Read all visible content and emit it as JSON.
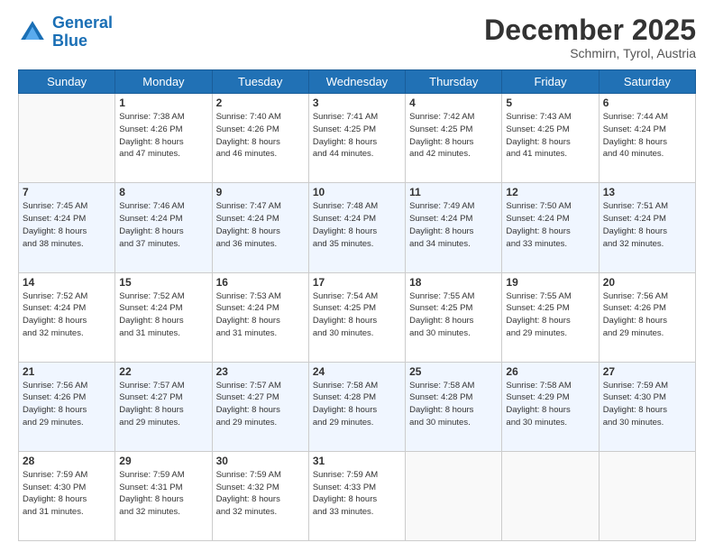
{
  "header": {
    "logo_line1": "General",
    "logo_line2": "Blue",
    "month": "December 2025",
    "location": "Schmirn, Tyrol, Austria"
  },
  "days_of_week": [
    "Sunday",
    "Monday",
    "Tuesday",
    "Wednesday",
    "Thursday",
    "Friday",
    "Saturday"
  ],
  "weeks": [
    [
      {
        "day": "",
        "info": ""
      },
      {
        "day": "1",
        "info": "Sunrise: 7:38 AM\nSunset: 4:26 PM\nDaylight: 8 hours\nand 47 minutes."
      },
      {
        "day": "2",
        "info": "Sunrise: 7:40 AM\nSunset: 4:26 PM\nDaylight: 8 hours\nand 46 minutes."
      },
      {
        "day": "3",
        "info": "Sunrise: 7:41 AM\nSunset: 4:25 PM\nDaylight: 8 hours\nand 44 minutes."
      },
      {
        "day": "4",
        "info": "Sunrise: 7:42 AM\nSunset: 4:25 PM\nDaylight: 8 hours\nand 42 minutes."
      },
      {
        "day": "5",
        "info": "Sunrise: 7:43 AM\nSunset: 4:25 PM\nDaylight: 8 hours\nand 41 minutes."
      },
      {
        "day": "6",
        "info": "Sunrise: 7:44 AM\nSunset: 4:24 PM\nDaylight: 8 hours\nand 40 minutes."
      }
    ],
    [
      {
        "day": "7",
        "info": "Sunrise: 7:45 AM\nSunset: 4:24 PM\nDaylight: 8 hours\nand 38 minutes."
      },
      {
        "day": "8",
        "info": "Sunrise: 7:46 AM\nSunset: 4:24 PM\nDaylight: 8 hours\nand 37 minutes."
      },
      {
        "day": "9",
        "info": "Sunrise: 7:47 AM\nSunset: 4:24 PM\nDaylight: 8 hours\nand 36 minutes."
      },
      {
        "day": "10",
        "info": "Sunrise: 7:48 AM\nSunset: 4:24 PM\nDaylight: 8 hours\nand 35 minutes."
      },
      {
        "day": "11",
        "info": "Sunrise: 7:49 AM\nSunset: 4:24 PM\nDaylight: 8 hours\nand 34 minutes."
      },
      {
        "day": "12",
        "info": "Sunrise: 7:50 AM\nSunset: 4:24 PM\nDaylight: 8 hours\nand 33 minutes."
      },
      {
        "day": "13",
        "info": "Sunrise: 7:51 AM\nSunset: 4:24 PM\nDaylight: 8 hours\nand 32 minutes."
      }
    ],
    [
      {
        "day": "14",
        "info": "Sunrise: 7:52 AM\nSunset: 4:24 PM\nDaylight: 8 hours\nand 32 minutes."
      },
      {
        "day": "15",
        "info": "Sunrise: 7:52 AM\nSunset: 4:24 PM\nDaylight: 8 hours\nand 31 minutes."
      },
      {
        "day": "16",
        "info": "Sunrise: 7:53 AM\nSunset: 4:24 PM\nDaylight: 8 hours\nand 31 minutes."
      },
      {
        "day": "17",
        "info": "Sunrise: 7:54 AM\nSunset: 4:25 PM\nDaylight: 8 hours\nand 30 minutes."
      },
      {
        "day": "18",
        "info": "Sunrise: 7:55 AM\nSunset: 4:25 PM\nDaylight: 8 hours\nand 30 minutes."
      },
      {
        "day": "19",
        "info": "Sunrise: 7:55 AM\nSunset: 4:25 PM\nDaylight: 8 hours\nand 29 minutes."
      },
      {
        "day": "20",
        "info": "Sunrise: 7:56 AM\nSunset: 4:26 PM\nDaylight: 8 hours\nand 29 minutes."
      }
    ],
    [
      {
        "day": "21",
        "info": "Sunrise: 7:56 AM\nSunset: 4:26 PM\nDaylight: 8 hours\nand 29 minutes."
      },
      {
        "day": "22",
        "info": "Sunrise: 7:57 AM\nSunset: 4:27 PM\nDaylight: 8 hours\nand 29 minutes."
      },
      {
        "day": "23",
        "info": "Sunrise: 7:57 AM\nSunset: 4:27 PM\nDaylight: 8 hours\nand 29 minutes."
      },
      {
        "day": "24",
        "info": "Sunrise: 7:58 AM\nSunset: 4:28 PM\nDaylight: 8 hours\nand 29 minutes."
      },
      {
        "day": "25",
        "info": "Sunrise: 7:58 AM\nSunset: 4:28 PM\nDaylight: 8 hours\nand 30 minutes."
      },
      {
        "day": "26",
        "info": "Sunrise: 7:58 AM\nSunset: 4:29 PM\nDaylight: 8 hours\nand 30 minutes."
      },
      {
        "day": "27",
        "info": "Sunrise: 7:59 AM\nSunset: 4:30 PM\nDaylight: 8 hours\nand 30 minutes."
      }
    ],
    [
      {
        "day": "28",
        "info": "Sunrise: 7:59 AM\nSunset: 4:30 PM\nDaylight: 8 hours\nand 31 minutes."
      },
      {
        "day": "29",
        "info": "Sunrise: 7:59 AM\nSunset: 4:31 PM\nDaylight: 8 hours\nand 32 minutes."
      },
      {
        "day": "30",
        "info": "Sunrise: 7:59 AM\nSunset: 4:32 PM\nDaylight: 8 hours\nand 32 minutes."
      },
      {
        "day": "31",
        "info": "Sunrise: 7:59 AM\nSunset: 4:33 PM\nDaylight: 8 hours\nand 33 minutes."
      },
      {
        "day": "",
        "info": ""
      },
      {
        "day": "",
        "info": ""
      },
      {
        "day": "",
        "info": ""
      }
    ]
  ]
}
